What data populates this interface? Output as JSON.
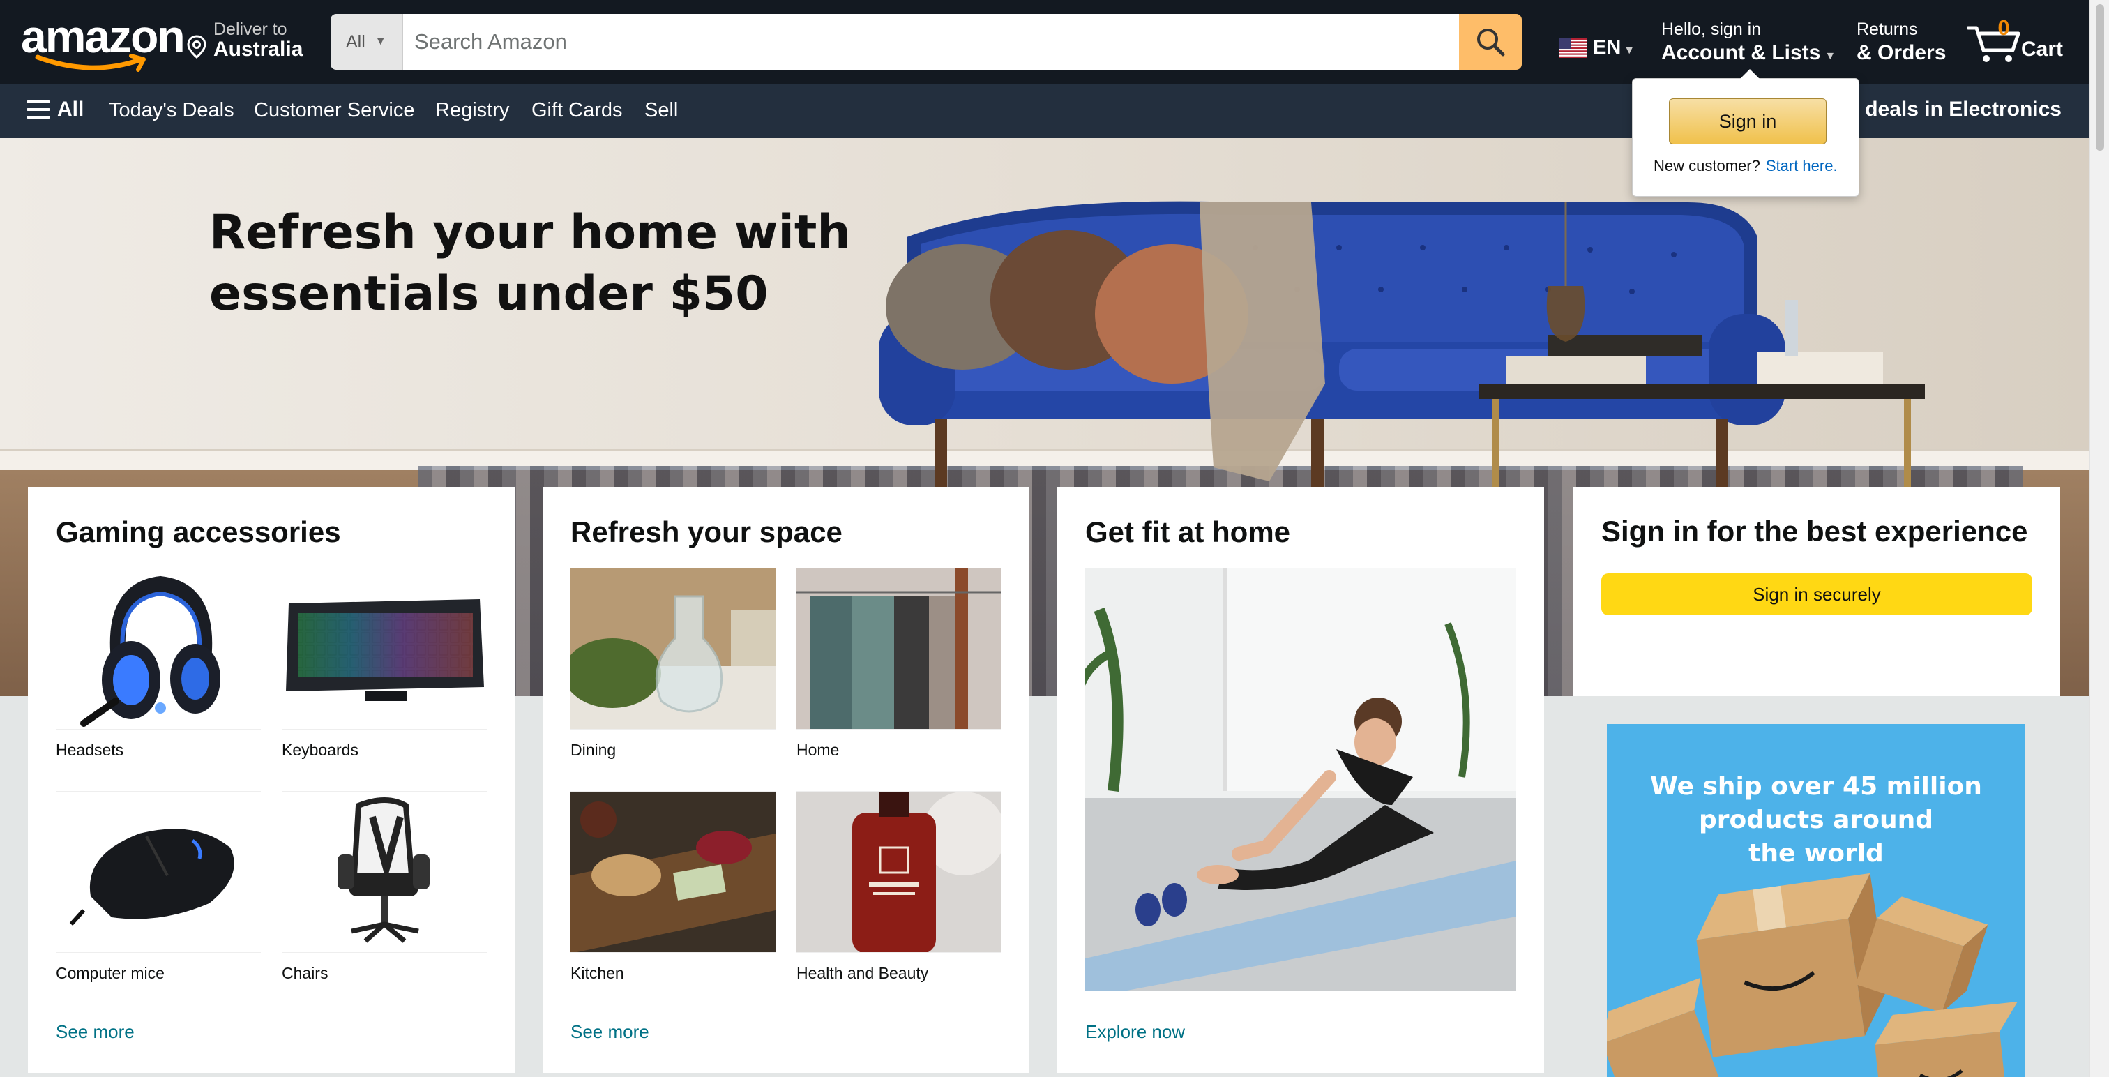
{
  "header": {
    "logo_text": "amazon",
    "deliver_line1": "Deliver to",
    "deliver_line2": "Australia",
    "search_category": "All",
    "search_placeholder": "Search Amazon",
    "language": "EN",
    "account_line1": "Hello, sign in",
    "account_line2": "Account & Lists",
    "returns_line1": "Returns",
    "returns_line2": "& Orders",
    "cart_count": "0",
    "cart_label": "Cart"
  },
  "subnav": {
    "all_label": "All",
    "links": [
      "Today's Deals",
      "Customer Service",
      "Registry",
      "Gift Cards",
      "Sell"
    ],
    "promo": "Shop deals in Electronics"
  },
  "flyout": {
    "sign_in": "Sign in",
    "new_customer": "New customer?",
    "start_here": "Start here."
  },
  "hero": {
    "headline_line1": "Refresh your home with",
    "headline_line2": "essentials under $50"
  },
  "cards": [
    {
      "title": "Gaming accessories",
      "items": [
        "Headsets",
        "Keyboards",
        "Computer mice",
        "Chairs"
      ],
      "link": "See more"
    },
    {
      "title": "Refresh your space",
      "items": [
        "Dining",
        "Home",
        "Kitchen",
        "Health and Beauty"
      ],
      "link": "See more"
    },
    {
      "title": "Get fit at home",
      "link": "Explore now"
    }
  ],
  "signin_card": {
    "title": "Sign in for the best experience",
    "button": "Sign in securely"
  },
  "ad": {
    "line1": "We ship over 45 million",
    "line2": "products around",
    "line3": "the world"
  },
  "colors": {
    "nav_dark": "#131921",
    "nav_sub": "#232f3e",
    "search_button": "#febd69",
    "cart_count": "#f08804",
    "link": "#007185",
    "primary_button": "#ffd814",
    "ad_background": "#4db2e9"
  },
  "icons": {
    "search": "magnifier-icon",
    "location": "location-pin-icon",
    "cart": "cart-icon",
    "menu": "hamburger-icon",
    "flag": "us-flag-icon"
  }
}
